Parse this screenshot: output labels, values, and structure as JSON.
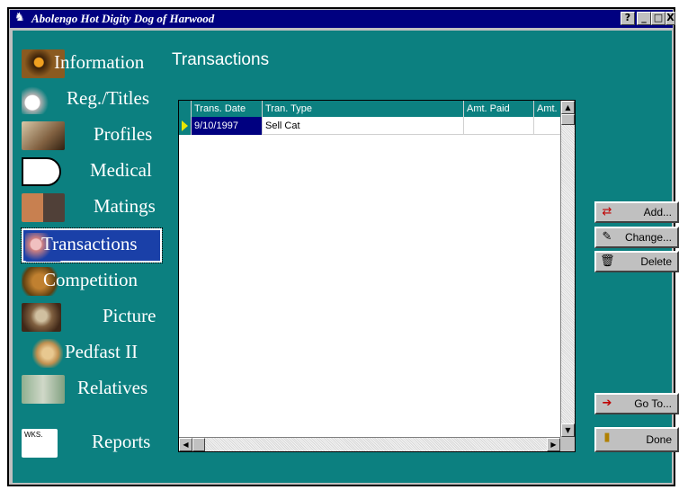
{
  "window": {
    "title": "Abolengo Hot Digity Dog of Harwood",
    "help_btn": "?",
    "min_btn": "_",
    "max_btn": "□",
    "close_btn": "X"
  },
  "sidebar": {
    "items": [
      {
        "label": "Information",
        "thumb_color": "#8a5a20"
      },
      {
        "label": "Reg./Titles",
        "thumb_color": "#d8d8d8"
      },
      {
        "label": "Profiles",
        "thumb_color": "#b89a70"
      },
      {
        "label": "Medical",
        "thumb_color": "#ffffff"
      },
      {
        "label": "Matings",
        "thumb_color": "#c08060"
      },
      {
        "label": "Transactions",
        "thumb_color": "#e0b0b0"
      },
      {
        "label": "Competition",
        "thumb_color": "#a06820"
      },
      {
        "label": "Picture",
        "thumb_color": "#a08870"
      },
      {
        "label": "Pedfast II",
        "thumb_color": "#d4a860"
      },
      {
        "label": "Relatives",
        "thumb_color": "#a0c0a0"
      },
      {
        "label": "Reports",
        "thumb_color": "#ffffff",
        "thumb_text": "WKS."
      }
    ]
  },
  "main": {
    "heading": "Transactions",
    "table": {
      "columns": [
        "Trans. Date",
        "Tran. Type",
        "Amt. Paid",
        "Amt."
      ],
      "rows": [
        [
          "9/10/1997",
          "Sell Cat",
          "",
          ""
        ]
      ]
    }
  },
  "actions": {
    "add": "Add...",
    "change": "Change...",
    "delete": "Delete",
    "goto": "Go To...",
    "done": "Done"
  },
  "colors": {
    "accent": "#0c8080",
    "titlebar": "#000080",
    "selection": "#000080"
  }
}
